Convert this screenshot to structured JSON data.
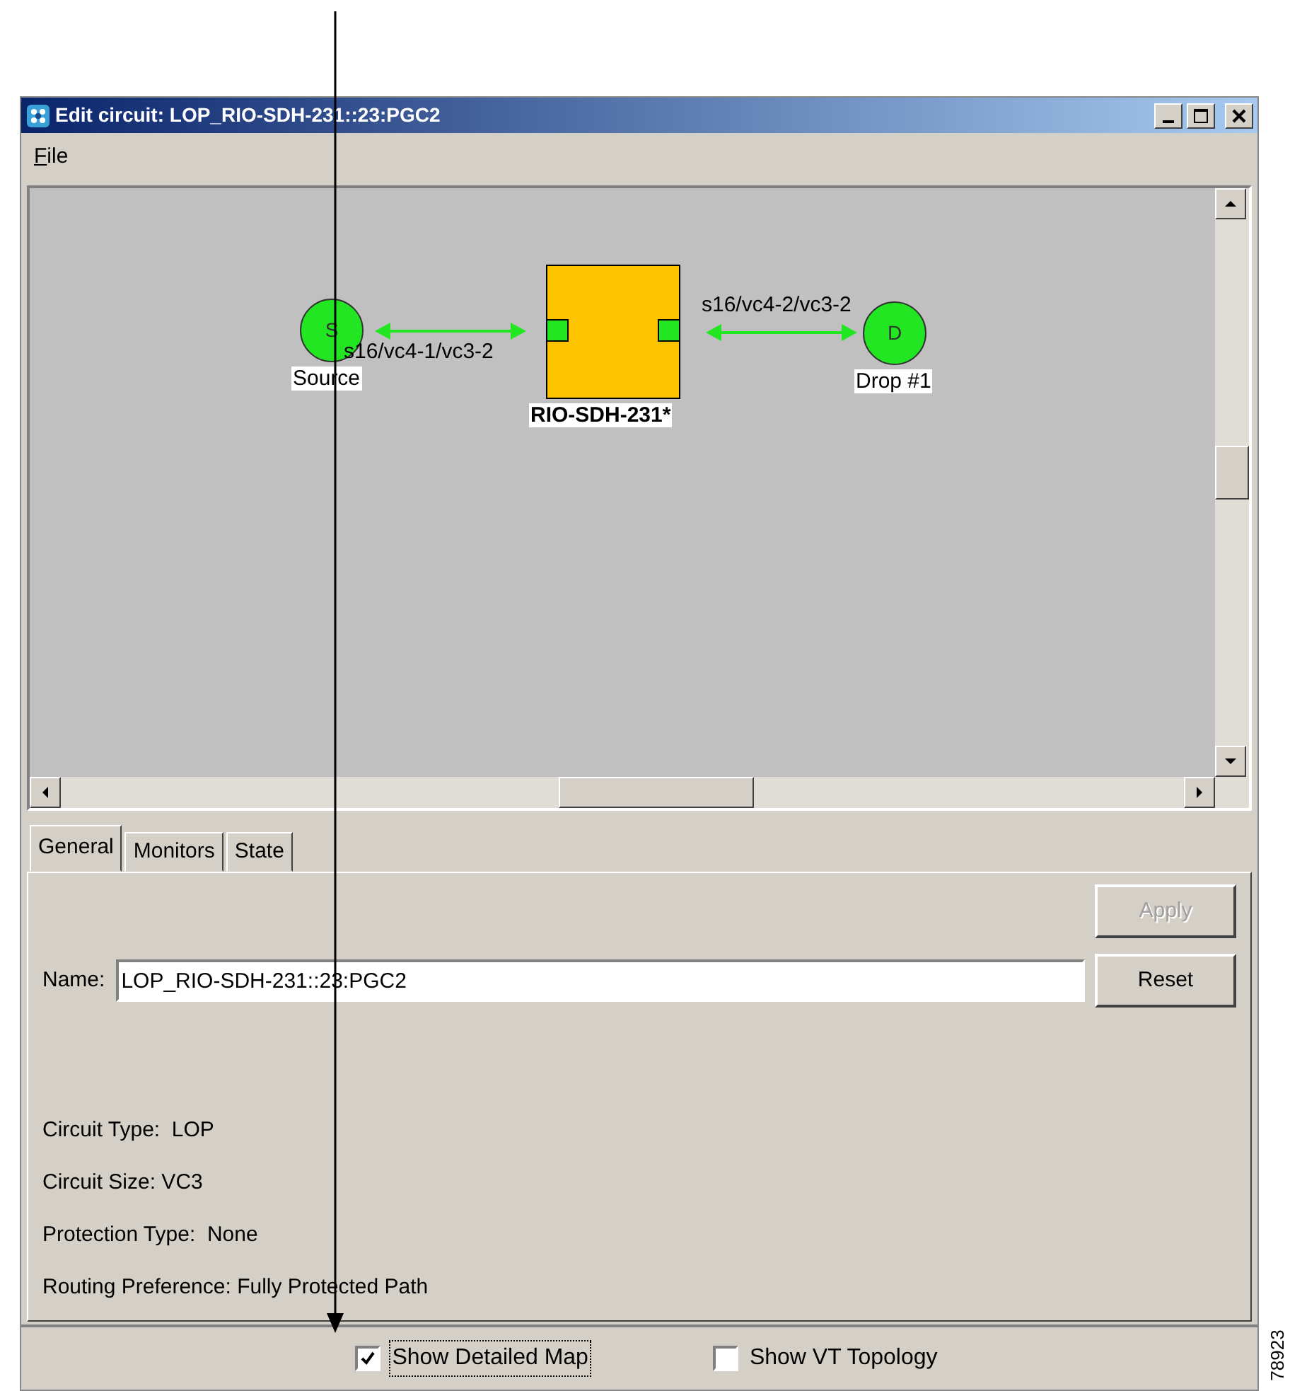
{
  "window": {
    "title": "Edit circuit: LOP_RIO-SDH-231::23:PGC2"
  },
  "menu": [
    {
      "label": "File"
    }
  ],
  "diagram": {
    "nodes": [
      {
        "kind": "endpoint",
        "letter": "S",
        "label": "Source"
      },
      {
        "kind": "node",
        "label": "RIO-SDH-231*"
      },
      {
        "kind": "endpoint",
        "letter": "D",
        "label": "Drop #1"
      }
    ],
    "links": [
      {
        "label": "s16/vc4-1/vc3-2"
      },
      {
        "label": "s16/vc4-2/vc3-2"
      }
    ]
  },
  "tabs": [
    {
      "label": "General",
      "selected": true
    },
    {
      "label": "Monitors",
      "selected": false
    },
    {
      "label": "State",
      "selected": false
    }
  ],
  "name_field": {
    "label": "Name:",
    "value": "LOP_RIO-SDH-231::23:PGC2"
  },
  "buttons": [
    {
      "label": "Apply",
      "disabled": true
    },
    {
      "label": "Reset",
      "disabled": false
    }
  ],
  "details": [
    "Circuit Type:  LOP",
    "Circuit Size: VC3",
    "Protection Type:  None",
    "Routing Preference: Fully Protected Path"
  ],
  "options": [
    {
      "label": "Show Detailed Map",
      "checked": true
    },
    {
      "label": "Show VT Topology",
      "checked": false
    }
  ],
  "figure_id": "78923"
}
